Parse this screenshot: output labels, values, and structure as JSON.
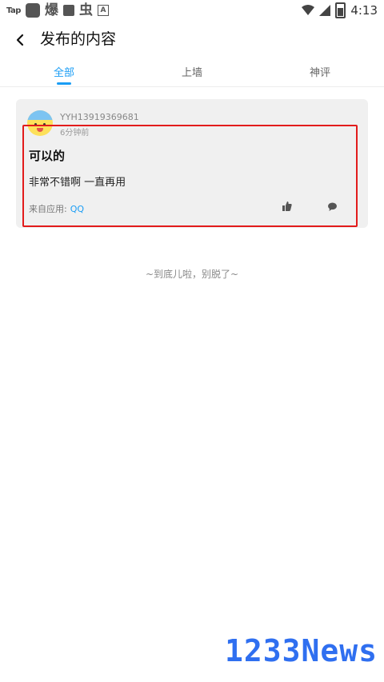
{
  "status_bar": {
    "left_label": "Tap",
    "glyph_1": "爆",
    "glyph_2": "虫",
    "glyph_3": "A",
    "time": "4:13",
    "icons": [
      "square-app-icon",
      "bag-icon",
      "wifi-icon",
      "signal-icon",
      "battery-icon"
    ]
  },
  "header": {
    "title": "发布的内容",
    "back_icon": "chevron-left-icon"
  },
  "tabs": [
    {
      "label": "全部",
      "active": true
    },
    {
      "label": "上墙",
      "active": false
    },
    {
      "label": "神评",
      "active": false
    }
  ],
  "post": {
    "username": "YYH13919369681",
    "time_ago": "6分钟前",
    "title": "可以的",
    "body": "非常不错啊  一直再用",
    "source_label": "来自应用:",
    "source_app": "QQ"
  },
  "end_message": "~到底儿啦，别脱了~",
  "watermark": "1233News",
  "colors": {
    "accent": "#1a9df5",
    "highlight": "#e21b1b",
    "card_bg": "#f0f0f0"
  }
}
